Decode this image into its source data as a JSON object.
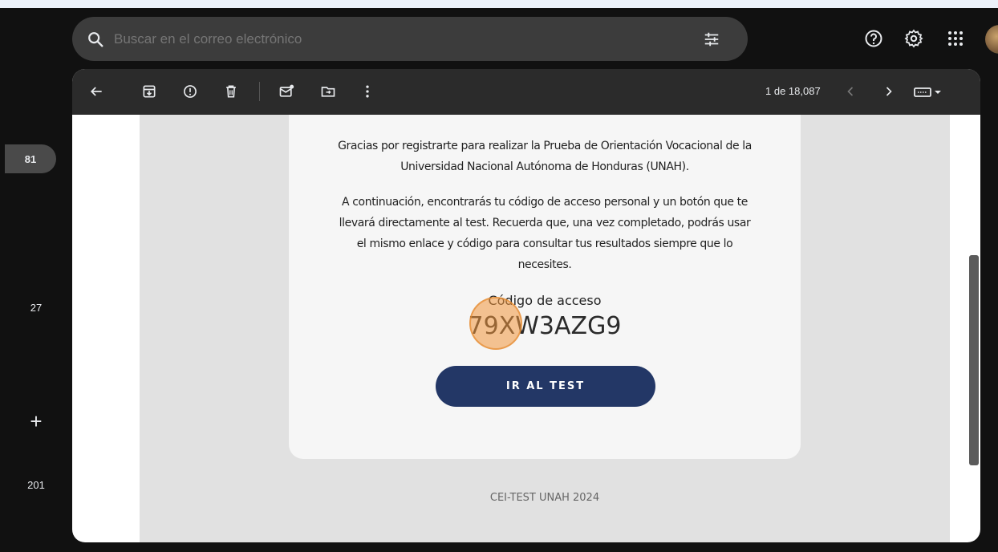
{
  "search": {
    "placeholder": "Buscar en el correo electrónico"
  },
  "rail": {
    "badge": "81",
    "counts": [
      "27",
      "201"
    ],
    "plus": "+"
  },
  "toolbar": {
    "icons": [
      "back-icon",
      "archive-icon",
      "report-spam-icon",
      "delete-icon",
      "mark-unread-icon",
      "move-to-icon",
      "more-icon"
    ],
    "pager": "1 de 18,087"
  },
  "email": {
    "intro": "Gracias por registrarte para realizar la Prueba de Orientación Vocacional de la Universidad Nacional Autónoma de Honduras (UNAH).",
    "details": "A continuación, encontrarás tu código de acceso personal y un botón que te llevará directamente al test. Recuerda que, una vez completado, podrás usar el mismo enlace y código para consultar tus resultados siempre que lo necesites.",
    "code_label": "Código de acceso",
    "code_value": "79XW3AZG9",
    "cta_label": "IR AL TEST",
    "footer": "CEI-TEST UNAH 2024"
  },
  "colors": {
    "cta": "#233766",
    "toolbar": "#2b2b2b",
    "search": "#3c3c3c"
  }
}
